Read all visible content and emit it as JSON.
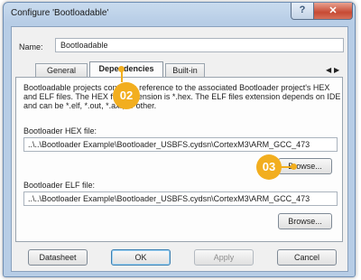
{
  "window": {
    "title": "Configure 'Bootloadable'",
    "help_glyph": "?",
    "close_glyph": "✕"
  },
  "name": {
    "label": "Name:",
    "value": "Bootloadable"
  },
  "tabs": [
    {
      "label": "General"
    },
    {
      "label": "Dependencies"
    },
    {
      "label": "Built-in"
    }
  ],
  "tab_scroll": {
    "left": "◀",
    "right": "▶"
  },
  "description": "Bootloadable projects contain a reference to the associated Bootloader project's HEX and ELF files. The HEX files extension is *.hex. The ELF files extension depends on IDE and can be *.elf, *.out, *.axf, or other.",
  "hex": {
    "label": "Bootloader HEX file:",
    "path": "..\\..\\Bootloader Example\\Bootloader_USBFS.cydsn\\CortexM3\\ARM_GCC_473",
    "browse": "Browse..."
  },
  "elf": {
    "label": "Bootloader ELF file:",
    "path": "..\\..\\Bootloader Example\\Bootloader_USBFS.cydsn\\CortexM3\\ARM_GCC_473",
    "browse": "Browse..."
  },
  "buttons": {
    "datasheet": "Datasheet",
    "ok": "OK",
    "apply": "Apply",
    "cancel": "Cancel"
  },
  "callouts": {
    "c02": "02",
    "c03": "03"
  },
  "colors": {
    "callout": "#f2ae1f",
    "title_bar": "#c9dbee",
    "close_button": "#c74a34"
  }
}
